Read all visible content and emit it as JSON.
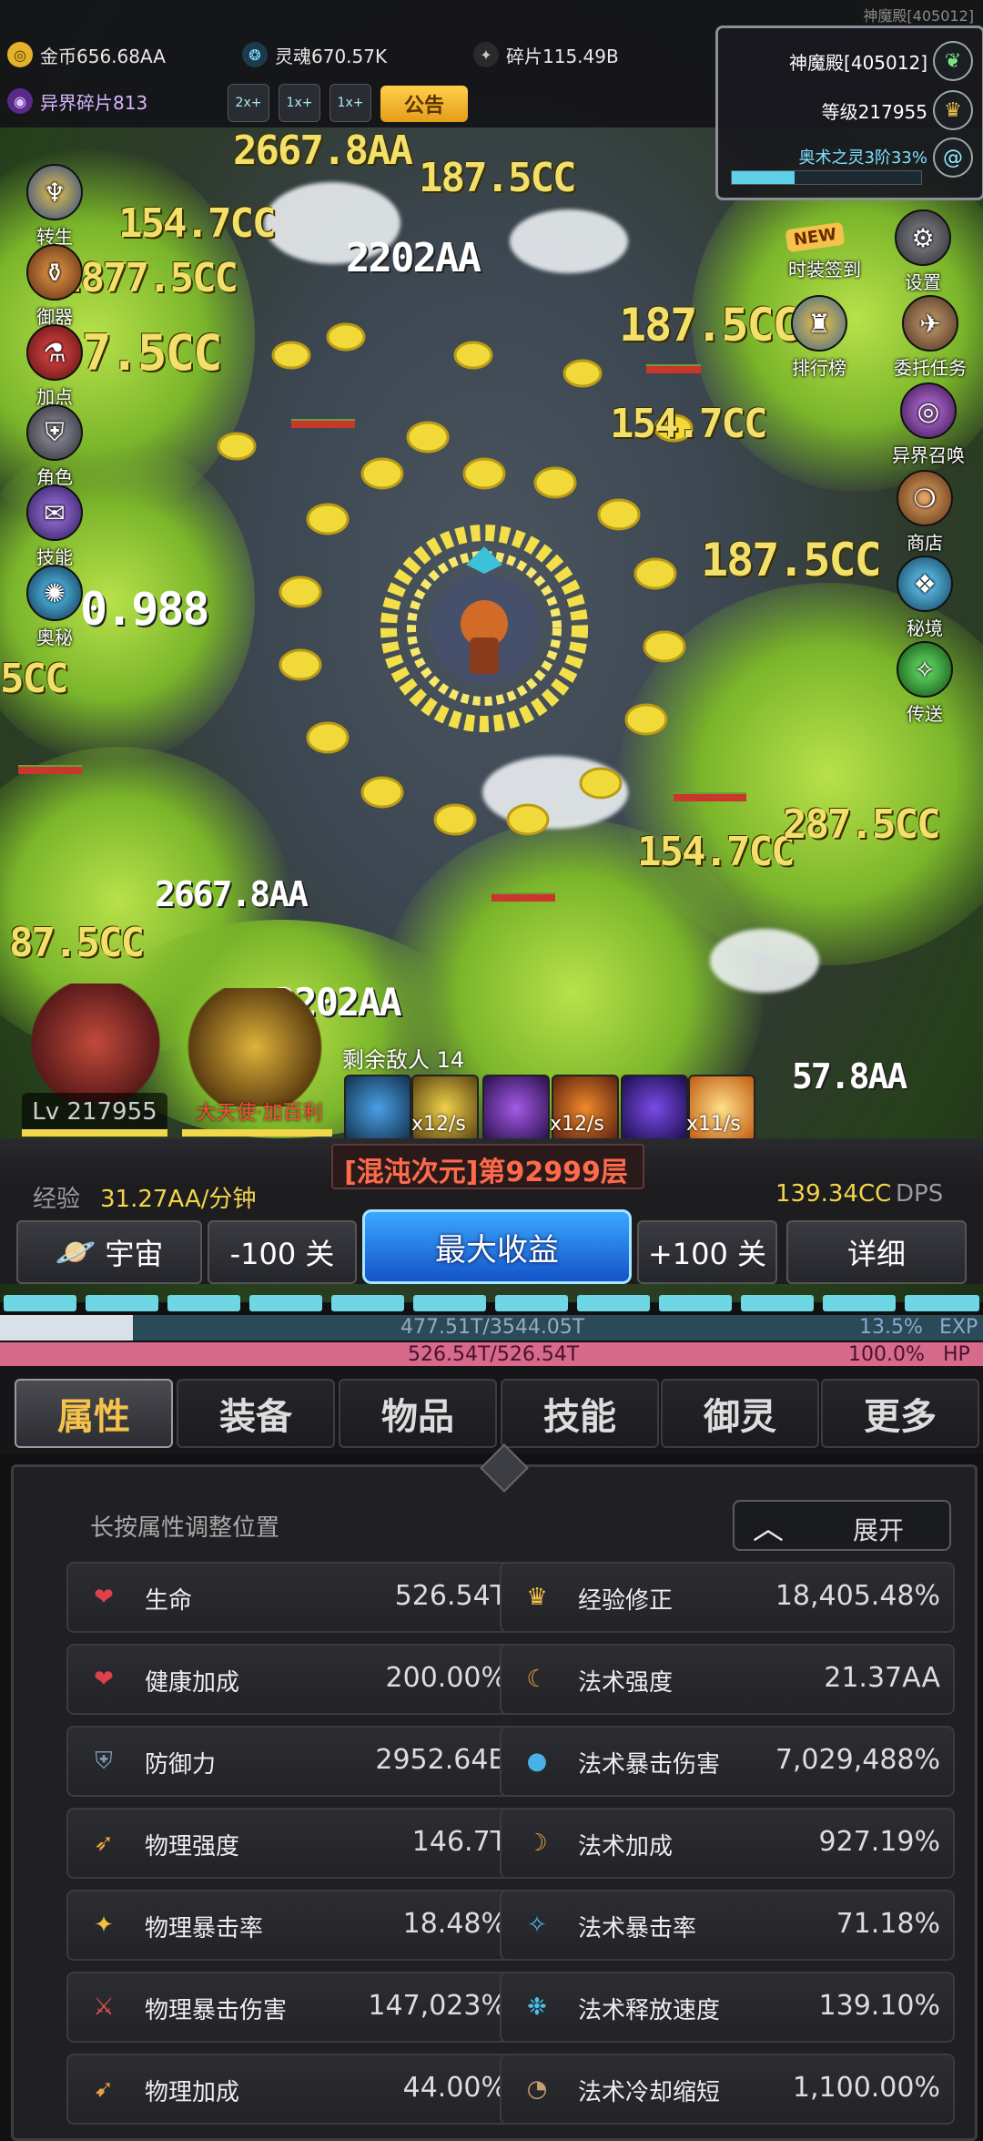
{
  "top": {
    "gold": "金币656.68AA",
    "soul": "灵魂670.57K",
    "fragment": "碎片115.49B",
    "shard": "异界碎片813",
    "speed_buttons": [
      "2x+",
      "1x+",
      "1x+"
    ],
    "notice": "公告"
  },
  "panel": {
    "server_tag": "神魔殿[405012]",
    "guild": "神魔殿[405012]",
    "level": "等级217955",
    "arcane": "奥术之灵3阶33%",
    "arcane_progress": 0.33
  },
  "left_menu": [
    "转生",
    "御器",
    "加点",
    "角色",
    "技能",
    "奥秘"
  ],
  "right_menu": {
    "new_badge": "NEW",
    "items": [
      "设置",
      "时装签到",
      "排行榜",
      "委托任务",
      "异界召唤",
      "商店",
      "秘境",
      "传送"
    ]
  },
  "damage_numbers": [
    "2667.8AA",
    "187.5CC",
    "154.7CC",
    "2202AA",
    "2877.5CC",
    "7.5CC",
    "0.988",
    "5CC",
    "187.5CC",
    "154.7CC",
    "2667.8AA",
    "87.5CC",
    "2202AA",
    "154.7CC",
    "287.5CC",
    "187.5CC",
    "57.8AA"
  ],
  "battle": {
    "remaining": "剩余敌人 14",
    "player_level": "Lv 217955",
    "pet_name": "大天使·加百利",
    "skill_rates": [
      "x12/s",
      "x12/s",
      "x11/s"
    ]
  },
  "level": {
    "exp_label": "经验",
    "exp_rate": "31.27AA/分钟",
    "stage": "[混沌次元]第92999层",
    "dps_value": "139.34CC",
    "dps_label": "DPS",
    "universe_btn": "宇宙",
    "minus_btn": "-100 关",
    "max_btn": "最大收益",
    "plus_btn": "+100 关",
    "detail_btn": "详细"
  },
  "bars": {
    "exp_text": "477.51T/3544.05T",
    "exp_pct": "13.5%",
    "exp_tag": "EXP",
    "exp_fraction": 0.135,
    "hp_text": "526.54T/526.54T",
    "hp_pct": "100.0%",
    "hp_tag": "HP",
    "hp_fraction": 1.0
  },
  "tabs": [
    "属性",
    "装备",
    "物品",
    "技能",
    "御灵",
    "更多"
  ],
  "attr": {
    "hint": "长按属性调整位置",
    "expand": "展开",
    "left": [
      {
        "name": "生命",
        "value": "526.54T",
        "icon": "heart-icon"
      },
      {
        "name": "健康加成",
        "value": "200.00%",
        "icon": "heart-plus-icon"
      },
      {
        "name": "防御力",
        "value": "2952.64B",
        "icon": "shield-icon"
      },
      {
        "name": "物理强度",
        "value": "146.7T",
        "icon": "sword-icon"
      },
      {
        "name": "物理暴击率",
        "value": "18.48%",
        "icon": "crit-icon"
      },
      {
        "name": "物理暴击伤害",
        "value": "147,023%",
        "icon": "crit-damage-icon"
      },
      {
        "name": "物理加成",
        "value": "44.00%",
        "icon": "sword-plus-icon"
      }
    ],
    "right": [
      {
        "name": "经验修正",
        "value": "18,405.48%",
        "icon": "crown-icon"
      },
      {
        "name": "法术强度",
        "value": "21.37AA",
        "icon": "staff-icon"
      },
      {
        "name": "法术暴击伤害",
        "value": "7,029,488%",
        "icon": "orb-icon"
      },
      {
        "name": "法术加成",
        "value": "927.19%",
        "icon": "staff-plus-icon"
      },
      {
        "name": "法术暴击率",
        "value": "71.18%",
        "icon": "spell-crit-icon"
      },
      {
        "name": "法术释放速度",
        "value": "139.10%",
        "icon": "speed-icon"
      },
      {
        "name": "法术冷却缩短",
        "value": "1,100.00%",
        "icon": "cooldown-icon"
      }
    ]
  }
}
